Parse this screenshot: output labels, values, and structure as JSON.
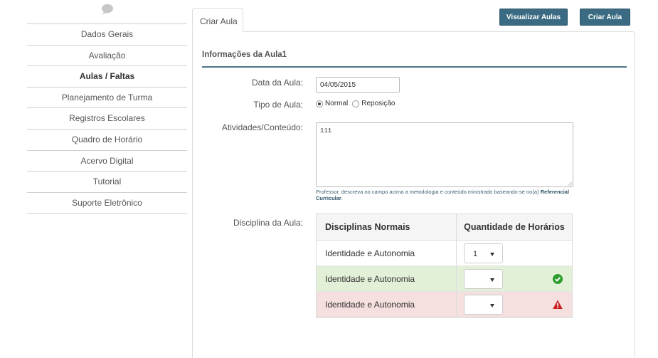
{
  "sidebar": {
    "items": [
      {
        "label": "Dados Gerais"
      },
      {
        "label": "Avaliação"
      },
      {
        "label": "Aulas / Faltas"
      },
      {
        "label": "Planejamento de Turma"
      },
      {
        "label": "Registros Escolares"
      },
      {
        "label": "Quadro de Horário"
      },
      {
        "label": "Acervo Digital"
      },
      {
        "label": "Tutorial"
      },
      {
        "label": "Suporte Eletrônico"
      }
    ],
    "active_index": 2
  },
  "tabs": {
    "active": "Criar Aula"
  },
  "header_buttons": {
    "view": "Visualizar Aulas",
    "create": "Criar Aula"
  },
  "form": {
    "section_title": "Informações da Aula1",
    "date_label": "Data da Aula:",
    "date_value": "04/05/2015",
    "tipo_label": "Tipo de Aula:",
    "tipo_options": [
      "Normal",
      "Reposição"
    ],
    "tipo_selected": "Normal",
    "atividades_label": "Atividades/Conteúdo:",
    "atividades_value": "111",
    "hint_text": "Professor, descreva no campo acima a metodologia e conteúdo ministrado baseando-se no(a) ",
    "hint_link": "Referencial Curricular",
    "hint_end": ".",
    "disciplina_label": "Disciplina da Aula:"
  },
  "table": {
    "headers": [
      "Disciplinas Normais",
      "Quantidade de Horários"
    ],
    "rows": [
      {
        "discipline": "Identidade e Autonomia",
        "quantity": "1",
        "status": "none"
      },
      {
        "discipline": "Identidade e Autonomia",
        "quantity": "",
        "status": "success"
      },
      {
        "discipline": "Identidade e Autonomia",
        "quantity": "",
        "status": "error"
      }
    ]
  },
  "icons": {
    "chat": "chat-bubble-icon",
    "success": "check-circle-icon",
    "error": "warning-triangle-icon"
  },
  "colors": {
    "accent": "#3a6b82",
    "success_bg": "#e3f0d8",
    "danger_bg": "#f5dfdf",
    "success_icon": "#2e9e2e",
    "error_icon": "#cc1f1f"
  }
}
